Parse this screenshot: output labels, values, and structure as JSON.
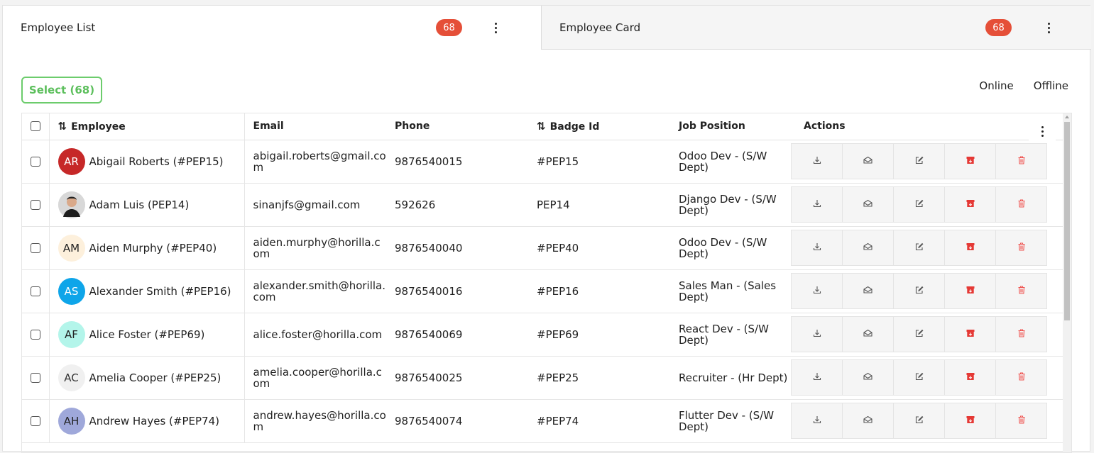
{
  "tabs": [
    {
      "label": "Employee List",
      "count": "68"
    },
    {
      "label": "Employee Card",
      "count": "68"
    }
  ],
  "toolbar": {
    "select_label": "Select (68)",
    "online_label": "Online",
    "offline_label": "Offline"
  },
  "columns": {
    "employee": "Employee",
    "email": "Email",
    "phone": "Phone",
    "badge_id": "Badge Id",
    "job_position": "Job Position",
    "actions": "Actions"
  },
  "colors": {
    "accent_green": "#5cbf5c",
    "badge_red": "#e54f38",
    "archive_red": "#e53935",
    "delete_red": "#ef5350"
  },
  "rows": [
    {
      "name": "Abigail Roberts (#PEP15)",
      "initials": "AR",
      "avatar_bg": "#c62828",
      "avatar_fg": "#ffffff",
      "email": "abigail.roberts@gmail.com",
      "phone": "9876540015",
      "badge": "#PEP15",
      "job": "Odoo Dev - (S/W Dept)"
    },
    {
      "name": "Adam Luis (PEP14)",
      "initials": "",
      "avatar_bg": "#d9d9d9",
      "avatar_fg": "#333333",
      "photo": true,
      "email": "sinanjfs@gmail.com",
      "phone": "592626",
      "badge": "PEP14",
      "job": "Django Dev - (S/W Dept)"
    },
    {
      "name": "Aiden Murphy (#PEP40)",
      "initials": "AM",
      "avatar_bg": "#fdf0dc",
      "avatar_fg": "#222222",
      "email": "aiden.murphy@horilla.com",
      "phone": "9876540040",
      "badge": "#PEP40",
      "job": "Odoo Dev - (S/W Dept)"
    },
    {
      "name": "Alexander Smith (#PEP16)",
      "initials": "AS",
      "avatar_bg": "#0ea5e9",
      "avatar_fg": "#ffffff",
      "email": "alexander.smith@horilla.com",
      "phone": "9876540016",
      "badge": "#PEP16",
      "job": "Sales Man - (Sales Dept)"
    },
    {
      "name": "Alice Foster (#PEP69)",
      "initials": "AF",
      "avatar_bg": "#b3f5ea",
      "avatar_fg": "#222222",
      "email": "alice.foster@horilla.com",
      "phone": "9876540069",
      "badge": "#PEP69",
      "job": "React Dev - (S/W Dept)"
    },
    {
      "name": "Amelia Cooper (#PEP25)",
      "initials": "AC",
      "avatar_bg": "#f0f0f0",
      "avatar_fg": "#333333",
      "email": "amelia.cooper@horilla.com",
      "phone": "9876540025",
      "badge": "#PEP25",
      "job": "Recruiter - (Hr Dept)"
    },
    {
      "name": "Andrew Hayes (#PEP74)",
      "initials": "AH",
      "avatar_bg": "#9fa8da",
      "avatar_fg": "#222222",
      "email": "andrew.hayes@horilla.com",
      "phone": "9876540074",
      "badge": "#PEP74",
      "job": "Flutter Dev - (S/W Dept)"
    }
  ],
  "row_actions": [
    {
      "name": "download-icon",
      "color": "#555555"
    },
    {
      "name": "mail-icon",
      "color": "#555555"
    },
    {
      "name": "edit-icon",
      "color": "#555555"
    },
    {
      "name": "archive-icon",
      "color": "#e53935"
    },
    {
      "name": "trash-icon",
      "color": "#ef5350"
    }
  ]
}
